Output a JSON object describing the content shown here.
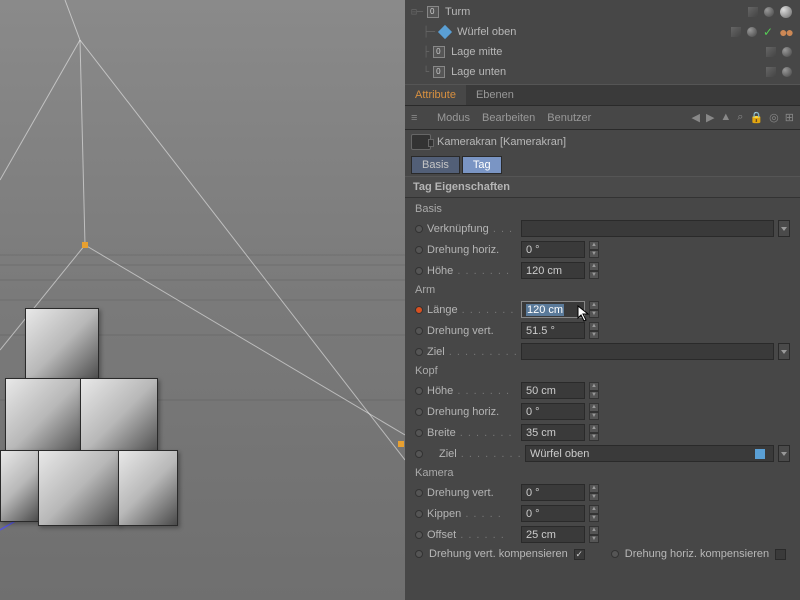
{
  "objects": [
    {
      "name": "Turm",
      "type": "null",
      "indent": 0,
      "tag": "ball"
    },
    {
      "name": "Würfel oben",
      "type": "cube",
      "indent": 1,
      "tag": "check"
    },
    {
      "name": "Lage mitte",
      "type": "null",
      "indent": 1,
      "tag": "none"
    },
    {
      "name": "Lage unten",
      "type": "null",
      "indent": 1,
      "tag": "none"
    }
  ],
  "tabs": {
    "attribute": "Attribute",
    "ebenen": "Ebenen"
  },
  "menubar": {
    "modus": "Modus",
    "bearbeiten": "Bearbeiten",
    "benutzer": "Benutzer"
  },
  "objectHeader": "Kamerakran [Kamerakran]",
  "subtabs": {
    "basis": "Basis",
    "tag": "Tag"
  },
  "sectionHeader": "Tag Eigenschaften",
  "groups": {
    "basis": {
      "label": "Basis",
      "verknuepfung": {
        "label": "Verknüpfung",
        "value": ""
      },
      "drehung_horiz": {
        "label": "Drehung horiz.",
        "value": "0 °"
      },
      "hoehe": {
        "label": "Höhe",
        "value": "120 cm"
      }
    },
    "arm": {
      "label": "Arm",
      "laenge": {
        "label": "Länge",
        "value": "120 cm"
      },
      "drehung_vert": {
        "label": "Drehung vert.",
        "value": "51.5 °"
      },
      "ziel": {
        "label": "Ziel",
        "value": ""
      }
    },
    "kopf": {
      "label": "Kopf",
      "hoehe": {
        "label": "Höhe",
        "value": "50 cm"
      },
      "drehung_horiz": {
        "label": "Drehung horiz.",
        "value": "0 °"
      },
      "breite": {
        "label": "Breite",
        "value": "35 cm"
      },
      "ziel": {
        "label": "Ziel",
        "value": "Würfel oben"
      }
    },
    "kamera": {
      "label": "Kamera",
      "drehung_vert": {
        "label": "Drehung vert.",
        "value": "0 °"
      },
      "kippen": {
        "label": "Kippen",
        "value": "0 °"
      },
      "offset": {
        "label": "Offset",
        "value": "25 cm"
      },
      "comp_vert": {
        "label": "Drehung vert. kompensieren",
        "checked": true
      },
      "comp_horiz": {
        "label": "Drehung horiz. kompensieren",
        "checked": false
      }
    }
  }
}
